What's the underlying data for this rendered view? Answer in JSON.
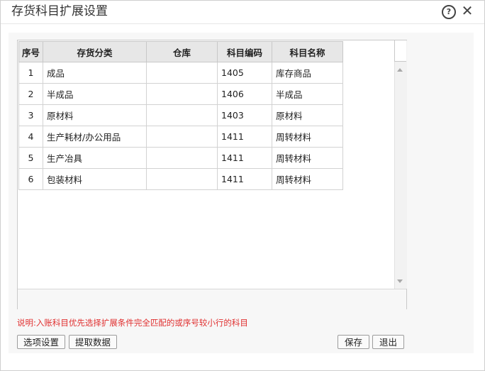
{
  "dialog": {
    "title": "存货科目扩展设置",
    "help_label": "?",
    "close_label": "✕"
  },
  "grid": {
    "columns": [
      "序号",
      "存货分类",
      "仓库",
      "科目编码",
      "科目名称"
    ],
    "rows": [
      {
        "idx": "1",
        "category": "成品",
        "warehouse": "",
        "code": "1405",
        "name": "库存商品"
      },
      {
        "idx": "2",
        "category": "半成品",
        "warehouse": "",
        "code": "1406",
        "name": "半成品"
      },
      {
        "idx": "3",
        "category": "原材料",
        "warehouse": "",
        "code": "1403",
        "name": "原材料"
      },
      {
        "idx": "4",
        "category": "生产耗材/办公用品",
        "warehouse": "",
        "code": "1411",
        "name": "周转材料"
      },
      {
        "idx": "5",
        "category": "生产冶具",
        "warehouse": "",
        "code": "1411",
        "name": "周转材料"
      },
      {
        "idx": "6",
        "category": "包装材料",
        "warehouse": "",
        "code": "1411",
        "name": "周转材料"
      }
    ]
  },
  "note": "说明:入账科目优先选择扩展条件完全匹配的或序号较小行的科目",
  "buttons": {
    "options": "选项设置",
    "fetch": "提取数据",
    "save": "保存",
    "exit": "退出"
  }
}
